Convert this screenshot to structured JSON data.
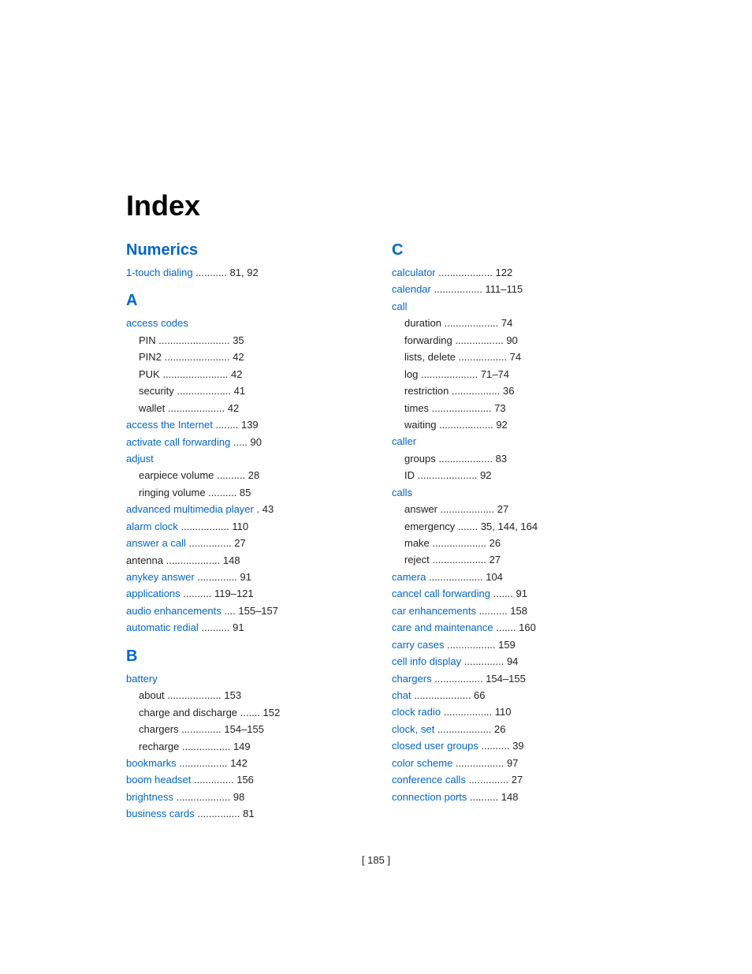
{
  "title": "Index",
  "footer": "[ 185 ]",
  "left_column": {
    "sections": [
      {
        "letter": "Numerics",
        "entries": [
          {
            "type": "blue",
            "text": "1-touch dialing",
            "dots": "...........",
            "page": "81, 92",
            "indent": 0
          }
        ]
      },
      {
        "letter": "A",
        "entries": [
          {
            "type": "blue",
            "text": "access codes",
            "dots": "",
            "page": "",
            "indent": 0
          },
          {
            "type": "black",
            "text": "PIN",
            "dots": ".........................",
            "page": "35",
            "indent": 1
          },
          {
            "type": "black",
            "text": "PIN2",
            "dots": ".......................",
            "page": "42",
            "indent": 1
          },
          {
            "type": "black",
            "text": "PUK",
            "dots": ".......................",
            "page": "42",
            "indent": 1
          },
          {
            "type": "black",
            "text": "security",
            "dots": "...................",
            "page": "41",
            "indent": 1
          },
          {
            "type": "black",
            "text": "wallet",
            "dots": "....................",
            "page": "42",
            "indent": 1
          },
          {
            "type": "blue",
            "text": "access the Internet",
            "dots": "........",
            "page": "139",
            "indent": 0
          },
          {
            "type": "blue",
            "text": "activate call forwarding",
            "dots": ".....",
            "page": "90",
            "indent": 0
          },
          {
            "type": "blue",
            "text": "adjust",
            "dots": "",
            "page": "",
            "indent": 0
          },
          {
            "type": "black",
            "text": "earpiece volume",
            "dots": "..........",
            "page": "28",
            "indent": 1
          },
          {
            "type": "black",
            "text": "ringing volume",
            "dots": "..........",
            "page": "85",
            "indent": 1
          },
          {
            "type": "blue",
            "text": "advanced multimedia player",
            "dots": ".",
            "page": "43",
            "indent": 0
          },
          {
            "type": "blue",
            "text": "alarm clock",
            "dots": ".................",
            "page": "110",
            "indent": 0
          },
          {
            "type": "blue",
            "text": "answer a call",
            "dots": "...............",
            "page": "27",
            "indent": 0
          },
          {
            "type": "black",
            "text": "antenna",
            "dots": "...................",
            "page": "148",
            "indent": 0
          },
          {
            "type": "blue",
            "text": "anykey answer",
            "dots": "..............",
            "page": "91",
            "indent": 0
          },
          {
            "type": "blue",
            "text": "applications",
            "dots": "..........",
            "page": "119–121",
            "indent": 0
          },
          {
            "type": "blue",
            "text": "audio enhancements",
            "dots": "....",
            "page": "155–157",
            "indent": 0
          },
          {
            "type": "blue",
            "text": "automatic redial",
            "dots": "..........",
            "page": "91",
            "indent": 0
          }
        ]
      },
      {
        "letter": "B",
        "entries": [
          {
            "type": "blue",
            "text": "battery",
            "dots": "",
            "page": "",
            "indent": 0
          },
          {
            "type": "black",
            "text": "about",
            "dots": "...................",
            "page": "153",
            "indent": 1
          },
          {
            "type": "black",
            "text": "charge and discharge",
            "dots": ".......",
            "page": "152",
            "indent": 1
          },
          {
            "type": "black",
            "text": "chargers",
            "dots": "..............",
            "page": "154–155",
            "indent": 1
          },
          {
            "type": "black",
            "text": "recharge",
            "dots": ".................",
            "page": "149",
            "indent": 1
          },
          {
            "type": "blue",
            "text": "bookmarks",
            "dots": ".................",
            "page": "142",
            "indent": 0
          },
          {
            "type": "blue",
            "text": "boom headset",
            "dots": "..............",
            "page": "156",
            "indent": 0
          },
          {
            "type": "blue",
            "text": "brightness",
            "dots": "...................",
            "page": "98",
            "indent": 0
          },
          {
            "type": "blue",
            "text": "business cards",
            "dots": "...............",
            "page": "81",
            "indent": 0
          }
        ]
      }
    ]
  },
  "right_column": {
    "sections": [
      {
        "letter": "C",
        "entries": [
          {
            "type": "blue",
            "text": "calculator",
            "dots": "...................",
            "page": "122",
            "indent": 0
          },
          {
            "type": "blue",
            "text": "calendar",
            "dots": ".................",
            "page": "111–115",
            "indent": 0
          },
          {
            "type": "blue",
            "text": "call",
            "dots": "",
            "page": "",
            "indent": 0
          },
          {
            "type": "black",
            "text": "duration",
            "dots": "...................",
            "page": "74",
            "indent": 1
          },
          {
            "type": "black",
            "text": "forwarding",
            "dots": ".................",
            "page": "90",
            "indent": 1
          },
          {
            "type": "black",
            "text": "lists, delete",
            "dots": ".................",
            "page": "74",
            "indent": 1
          },
          {
            "type": "black",
            "text": "log",
            "dots": "....................",
            "page": "71–74",
            "indent": 1
          },
          {
            "type": "black",
            "text": "restriction",
            "dots": ".................",
            "page": "36",
            "indent": 1
          },
          {
            "type": "black",
            "text": "times",
            "dots": ".....................",
            "page": "73",
            "indent": 1
          },
          {
            "type": "black",
            "text": "waiting",
            "dots": "...................",
            "page": "92",
            "indent": 1
          },
          {
            "type": "blue",
            "text": "caller",
            "dots": "",
            "page": "",
            "indent": 0
          },
          {
            "type": "black",
            "text": "groups",
            "dots": "...................",
            "page": "83",
            "indent": 1
          },
          {
            "type": "black",
            "text": "ID",
            "dots": ".....................",
            "page": "92",
            "indent": 1
          },
          {
            "type": "blue",
            "text": "calls",
            "dots": "",
            "page": "",
            "indent": 0
          },
          {
            "type": "black",
            "text": "answer",
            "dots": "...................",
            "page": "27",
            "indent": 1
          },
          {
            "type": "black",
            "text": "emergency",
            "dots": ".......",
            "page": "35, 144, 164",
            "indent": 1
          },
          {
            "type": "black",
            "text": "make",
            "dots": "...................",
            "page": "26",
            "indent": 1
          },
          {
            "type": "black",
            "text": "reject",
            "dots": "...................",
            "page": "27",
            "indent": 1
          },
          {
            "type": "blue",
            "text": "camera",
            "dots": "...................",
            "page": "104",
            "indent": 0
          },
          {
            "type": "blue",
            "text": "cancel call forwarding",
            "dots": ".......",
            "page": "91",
            "indent": 0
          },
          {
            "type": "blue",
            "text": "car enhancements",
            "dots": "..........",
            "page": "158",
            "indent": 0
          },
          {
            "type": "blue",
            "text": "care and maintenance",
            "dots": ".......",
            "page": "160",
            "indent": 0
          },
          {
            "type": "blue",
            "text": "carry cases",
            "dots": ".................",
            "page": "159",
            "indent": 0
          },
          {
            "type": "blue",
            "text": "cell info display",
            "dots": "..............",
            "page": "94",
            "indent": 0
          },
          {
            "type": "blue",
            "text": "chargers",
            "dots": ".................",
            "page": "154–155",
            "indent": 0
          },
          {
            "type": "blue",
            "text": "chat",
            "dots": "....................",
            "page": "66",
            "indent": 0
          },
          {
            "type": "blue",
            "text": "clock radio",
            "dots": ".................",
            "page": "110",
            "indent": 0
          },
          {
            "type": "blue",
            "text": "clock, set",
            "dots": "...................",
            "page": "26",
            "indent": 0
          },
          {
            "type": "blue",
            "text": "closed user groups",
            "dots": "..........",
            "page": "39",
            "indent": 0
          },
          {
            "type": "blue",
            "text": "color scheme",
            "dots": ".................",
            "page": "97",
            "indent": 0
          },
          {
            "type": "blue",
            "text": "conference calls",
            "dots": "..............",
            "page": "27",
            "indent": 0
          },
          {
            "type": "blue",
            "text": "connection ports",
            "dots": "..........",
            "page": "148",
            "indent": 0
          }
        ]
      }
    ]
  }
}
